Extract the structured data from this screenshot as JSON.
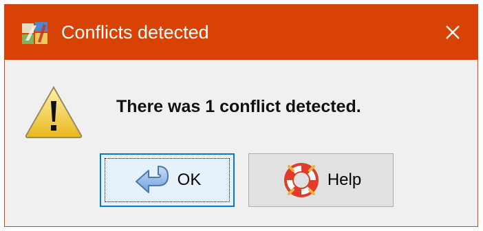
{
  "dialog": {
    "title": "Conflicts detected",
    "app_icon": "app-icon",
    "close_icon": "close-icon",
    "titlebar_color": "#d84305"
  },
  "message": {
    "icon": "warning-icon",
    "text": "There was 1 conflict detected."
  },
  "buttons": {
    "ok": {
      "label": "OK",
      "icon": "back-arrow-icon"
    },
    "help": {
      "label": "Help",
      "icon": "lifebuoy-icon"
    }
  }
}
